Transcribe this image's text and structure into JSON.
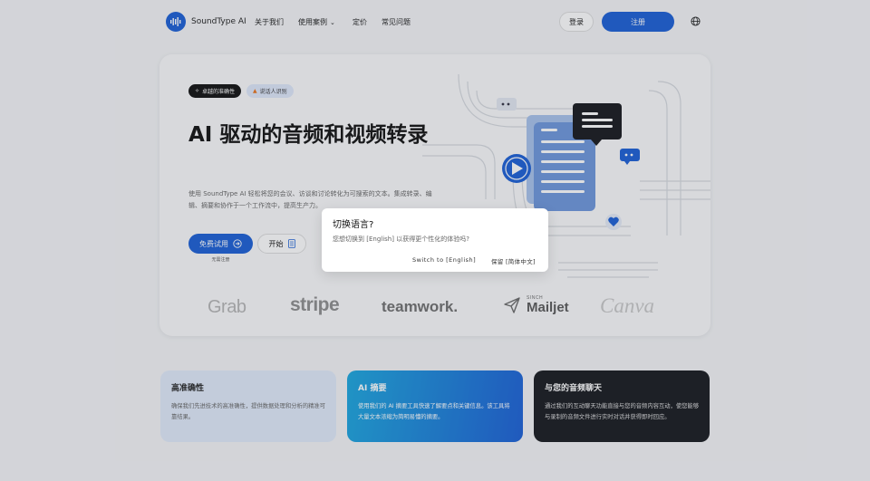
{
  "nav": {
    "logo_text": "SoundType AI",
    "about": "关于我们",
    "use_cases": "使用案例",
    "pricing": "定价",
    "faq": "常见问题",
    "login": "登录",
    "register": "注册"
  },
  "hero": {
    "badge_accuracy": "卓越的准确性",
    "badge_speaker": "说话人识别",
    "title": "AI 驱动的音频和视频转录",
    "description": "使用 SoundType AI 轻松将您的会议、访谈和讨论转化为可搜索的文本。集成转录、编辑、摘要和协作于一个工作流中，提高生产力。",
    "try_free": "免费试用",
    "no_registration": "无需注册",
    "start": "开始"
  },
  "logos": [
    "Grab",
    "stripe",
    "teamwork.",
    "SINCH",
    "Mailjet",
    "Canva"
  ],
  "features": [
    {
      "title": "高准确性",
      "body": "确保我们先进技术的高准确性，提供数据处理和分析的精准可靠结果。"
    },
    {
      "title": "AI 摘要",
      "body": "使用我们的 AI 摘要工具快速了解要点和关键信息。该工具将大量文本浓缩为简明易懂的摘要。"
    },
    {
      "title": "与您的音频聊天",
      "body": "通过我们的互动聊天功能直接与您的音频内容互动，使您能够与录制的音频文件进行实时对话并获得即时回应。"
    }
  ],
  "dialog": {
    "title": "切换语言?",
    "message": "您想切换到 [English] 以获得更个性化的体验吗?",
    "switch_button": "Switch to [English]",
    "keep_button": "保留 [简体中文]"
  },
  "colors": {
    "brand": "#1a5fd6",
    "dark_card": "#17191e",
    "light_card": "#e1ebfb"
  }
}
